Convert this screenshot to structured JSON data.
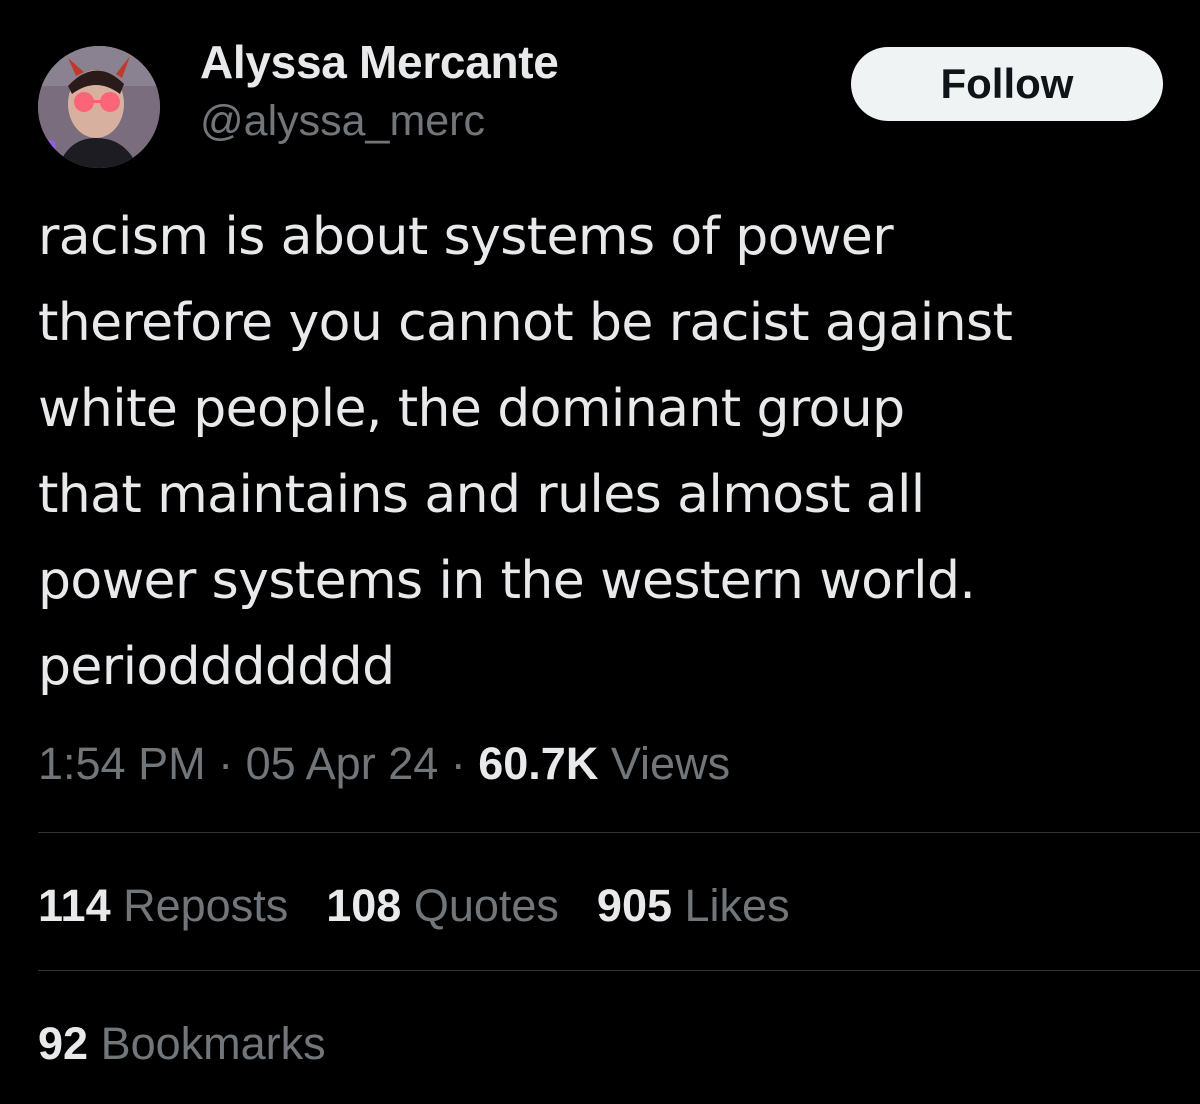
{
  "user": {
    "display_name": "Alyssa Mercante",
    "handle": "@alyssa_merc",
    "avatar_icon": "user-avatar"
  },
  "follow_button": {
    "label": "Follow"
  },
  "tweet": {
    "lines": [
      "racism is about systems of power",
      "therefore you cannot be racist against",
      "white people, the dominant group",
      "that maintains and rules almost all",
      "power systems in the western world.",
      "perioddddddd"
    ]
  },
  "meta": {
    "time": "1:54 PM",
    "separator": " · ",
    "date": "05 Apr 24",
    "views_count": "60.7K",
    "views_label": "Views"
  },
  "stats": {
    "reposts": {
      "count": "114",
      "label": "Reposts"
    },
    "quotes": {
      "count": "108",
      "label": "Quotes"
    },
    "likes": {
      "count": "905",
      "label": "Likes"
    },
    "bookmarks": {
      "count": "92",
      "label": "Bookmarks"
    }
  },
  "colors": {
    "background": "#000000",
    "primary_text": "#e7e9ea",
    "secondary_text": "#71767b",
    "divider": "#2f3336",
    "follow_bg": "#eff3f4"
  }
}
